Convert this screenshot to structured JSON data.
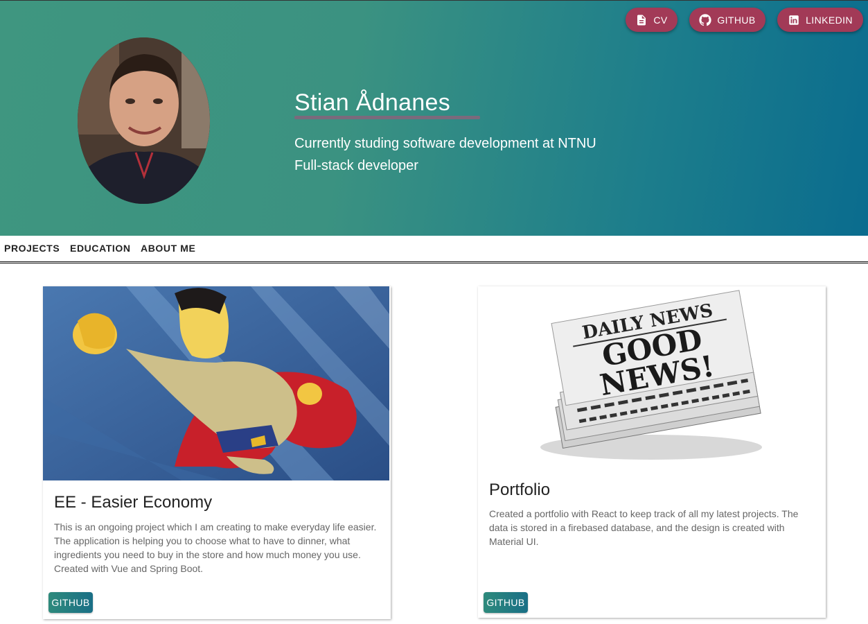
{
  "header": {
    "buttons": [
      {
        "label": "CV",
        "icon": "document-icon"
      },
      {
        "label": "GITHUB",
        "icon": "github-icon"
      },
      {
        "label": "LINKEDIN",
        "icon": "linkedin-icon"
      }
    ],
    "name": "Stian Ådnanes",
    "taglines": [
      "Currently studing software development at NTNU",
      "Full-stack developer"
    ],
    "colors": {
      "gradient_start": "#3f9680",
      "gradient_end": "#0a6c8e",
      "button": "#a23a57"
    }
  },
  "nav": {
    "items": [
      "PROJECTS",
      "EDUCATION",
      "ABOUT ME"
    ]
  },
  "projects": [
    {
      "title": "EE - Easier Economy",
      "description": "This is an ongoing project which I am creating to make everyday life easier. The application is helping you to choose what to have to dinner, what ingredients you need to buy in the store and how much money you use. Created with Vue and Spring Boot.",
      "button": "GITHUB",
      "image": "superhero-illustration"
    },
    {
      "title": "Portfolio",
      "description": "Created a portfolio with React to keep track of all my latest projects. The data is stored in a firebased database, and the design is created with Material UI.",
      "button": "GITHUB",
      "image": "newspaper-image",
      "image_text": {
        "line1": "DAILY NEWS",
        "line2": "GOOD",
        "line3": "NEWS!"
      }
    }
  ]
}
